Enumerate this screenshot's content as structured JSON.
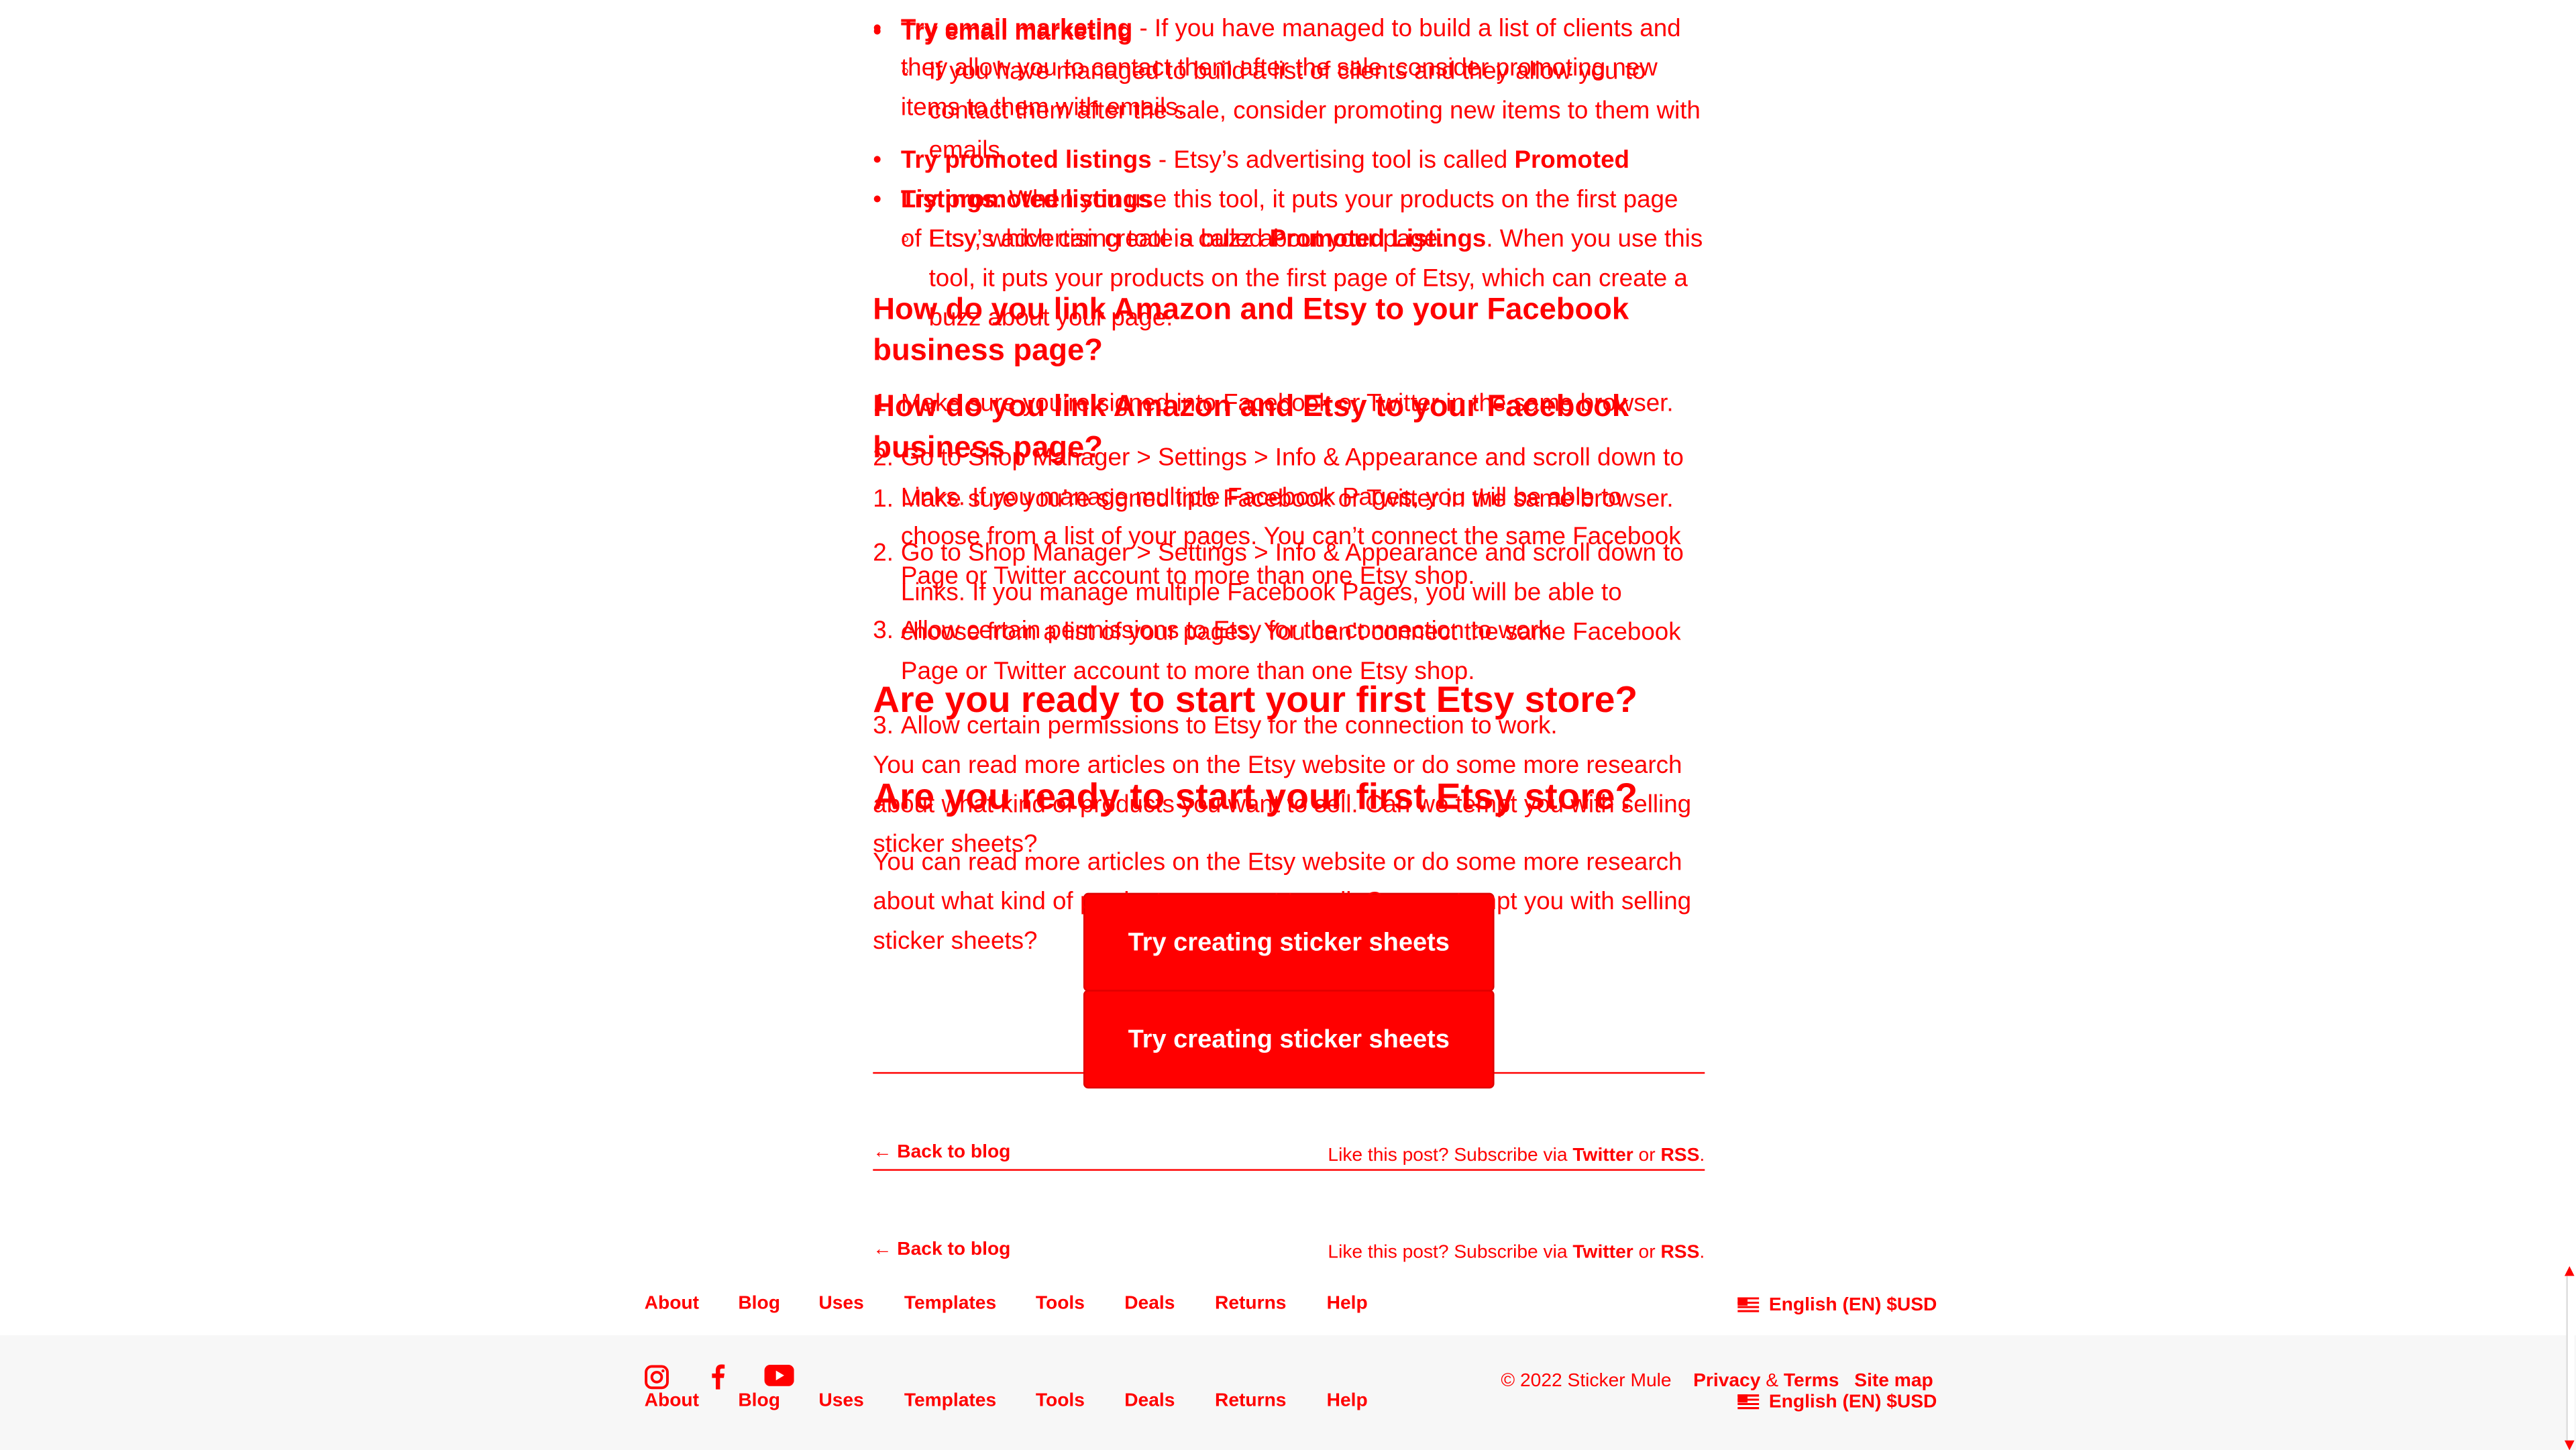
{
  "article": {
    "email_title": "Try email marketing",
    "email_body": " - If you have managed to build a list of clients and they allow you to contact them after the sale, consider promoting new items to them with emails.",
    "email_sub": "If you have managed to build a list of clients and they allow you to contact them after the sale, consider promoting new items to them with emails.",
    "promoted_title": "Try promoted listings",
    "promoted_pre": " - Etsy’s advertising tool is called ",
    "promoted_strong": "Promoted Listings",
    "promoted_post": ". When you use this tool, it puts your products on the first page of Etsy, which can create a buzz about your page.",
    "promoted_sub_pre": "Etsy’s advertising tool is called ",
    "promoted_sub_post": ". When you use this tool, it puts your products on the first page of Etsy, which can create a buzz about your page.",
    "facebook_heading": "How do you link Amazon and Etsy to your Facebook business page?",
    "steps": [
      {
        "n": "1.",
        "text": "Make sure you’re signed into Facebook or Twitter in the same browser."
      },
      {
        "n": "2.",
        "text": "Go to Shop Manager > Settings > Info & Appearance and scroll down to Links. If you manage multiple Facebook Pages, you will be able to choose from a list of your pages. You can’t connect the same Facebook Page or Twitter account to more than one Etsy shop."
      },
      {
        "n": "3.",
        "text": "Allow certain permissions to Etsy for the connection to work."
      }
    ],
    "cta_heading": "Are you ready to start your first Etsy store?",
    "cta_body": "You can read more articles on the Etsy website or do some more research about what kind of products you want to sell. Can we tempt you with selling sticker sheets?",
    "cta_button": "Try creating sticker sheets"
  },
  "post_footer": {
    "back_link": "← Back to blog",
    "subscribe_pre": "Like this post? Subscribe via ",
    "twitter": "Twitter",
    "or": " or ",
    "rss": "RSS",
    "end": "."
  },
  "footer": {
    "nav": [
      "About",
      "Blog",
      "Uses",
      "Templates",
      "Tools",
      "Deals",
      "Returns",
      "Help"
    ],
    "locale": "English (EN) $USD",
    "copyright": "© 2022 Sticker Mule",
    "privacy": "Privacy",
    "amp": " & ",
    "terms": "Terms",
    "sitemap": "Site map",
    "social_icons": [
      "instagram-icon",
      "facebook-icon",
      "youtube-icon"
    ]
  },
  "colors": {
    "text": "#ff0000",
    "button_text": "#ffffff",
    "background": "#ffffff",
    "footer_bg": "#f7f7f7"
  }
}
